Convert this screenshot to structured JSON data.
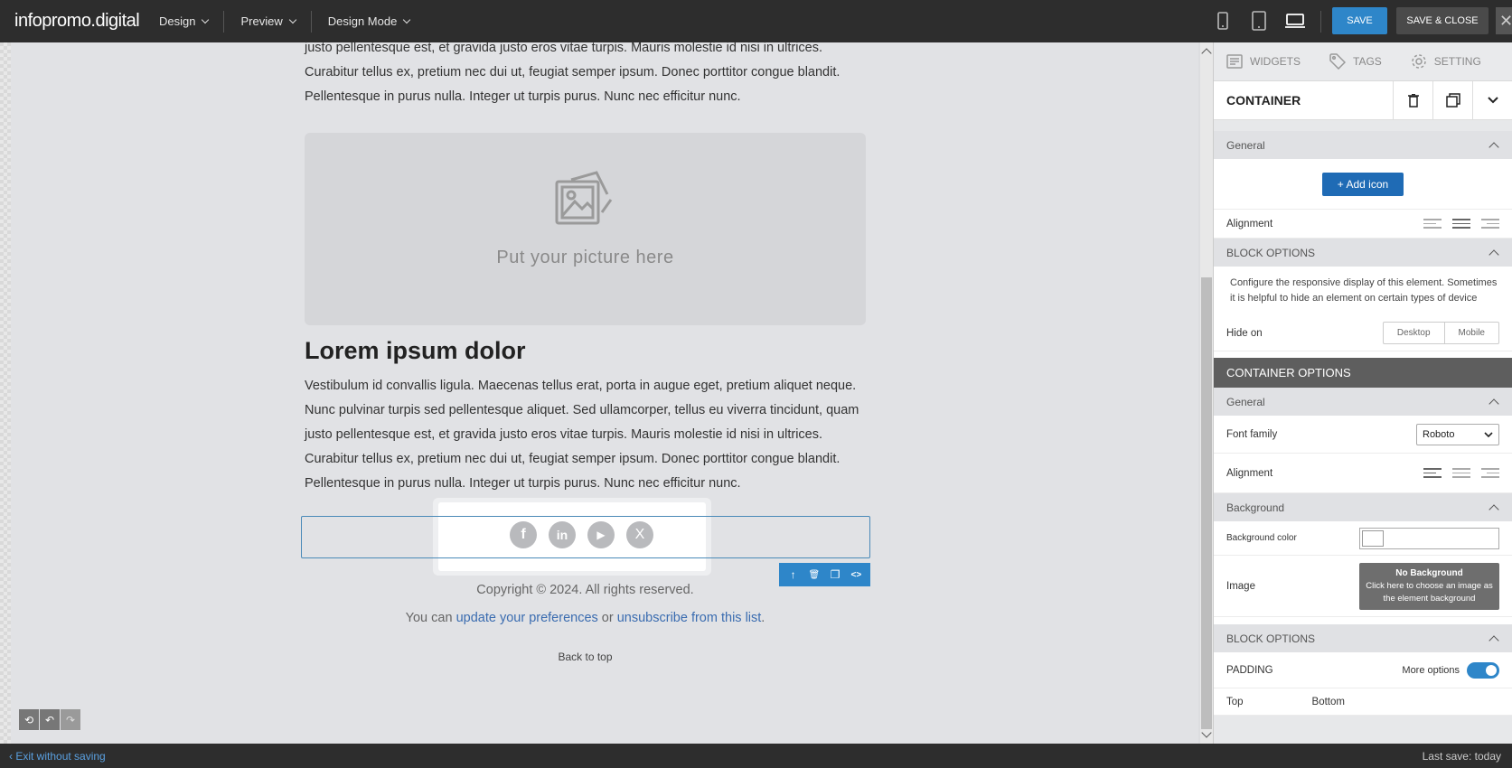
{
  "app": {
    "logo": "infopromo.digital"
  },
  "topbar": {
    "menus": [
      {
        "label": "Design"
      },
      {
        "label": "Preview"
      },
      {
        "label": "Design Mode"
      }
    ],
    "save_label": "SAVE",
    "save_close_label": "SAVE & CLOSE",
    "close_glyph": "✕",
    "devices": [
      "mobile-icon",
      "tablet-icon",
      "desktop-icon"
    ],
    "active_device": "desktop"
  },
  "canvas": {
    "top_paragraph": [
      "justo pellentesque est, et gravida justo eros vitae turpis. Mauris molestie id nisi in ultrices.",
      "Curabitur tellus ex, pretium nec dui ut, feugiat semper ipsum. Donec porttitor congue blandit.",
      "Pellentesque in purus nulla. Integer ut turpis purus. Nunc nec efficitur nunc."
    ],
    "picture_placeholder": "Put your picture here",
    "heading": "Lorem ipsum dolor",
    "body_paragraph": [
      "Vestibulum id convallis ligula. Maecenas tellus erat, porta in augue eget, pretium aliquet neque.",
      "Nunc pulvinar turpis sed pellentesque aliquet. Sed ullamcorper, tellus eu viverra tincidunt, quam",
      "justo pellentesque est, et gravida justo eros vitae turpis. Mauris molestie id nisi in ultrices.",
      "Curabitur tellus ex, pretium nec dui ut, feugiat semper ipsum. Donec porttitor congue blandit.",
      "Pellentesque in purus nulla. Integer ut turpis purus. Nunc nec efficitur nunc."
    ],
    "socials": [
      {
        "icon": "facebook-icon",
        "glyph": "f"
      },
      {
        "icon": "linkedin-icon",
        "glyph": "in"
      },
      {
        "icon": "youtube-icon",
        "glyph": "▶"
      },
      {
        "icon": "x-icon",
        "glyph": "X"
      }
    ],
    "block_toolbar": [
      "↑",
      "🗑",
      "❐",
      "<>"
    ],
    "copyright": "Copyright © 2024. All rights reserved.",
    "prefs": {
      "prefix": "You can",
      "link1": "update your preferences",
      "middle": "or",
      "link2": "unsubscribe from this list",
      "suffix": "."
    },
    "back_to_top": "Back to top",
    "history": [
      "⟲",
      "↶",
      "↷"
    ]
  },
  "panel": {
    "tabs": [
      {
        "label": "WIDGETS",
        "icon": "widgets-icon"
      },
      {
        "label": "TAGS",
        "icon": "tag-icon"
      },
      {
        "label": "SETTING",
        "icon": "gear-icon"
      }
    ],
    "header": {
      "title": "CONTAINER"
    },
    "general_label": "General",
    "add_icon_label": "+ Add icon",
    "alignment_label": "Alignment",
    "block_options_label": "BLOCK OPTIONS",
    "block_desc": "Configure the responsive display of this element. Sometimes it is helpful to hide an element on certain types of device",
    "hide_on_label": "Hide on",
    "hide_desktop": "Desktop",
    "hide_mobile": "Mobile",
    "container_options_label": "CONTAINER OPTIONS",
    "general2_label": "General",
    "font_family_label": "Font family",
    "font_family_value": "Roboto",
    "alignment2_label": "Alignment",
    "background_label": "Background",
    "bg_color_label": "Background color",
    "image_label": "Image",
    "no_bg_title": "No Background",
    "no_bg_text": "Click here to choose an image as the element background",
    "block_options2_label": "BLOCK OPTIONS",
    "padding_label": "PADDING",
    "more_options_label": "More options",
    "more_options_on": true,
    "top_label": "Top",
    "bottom_label": "Bottom"
  },
  "bottombar": {
    "exit_label": "Exit without saving",
    "last_save": "Last save: today"
  },
  "colors": {
    "accent": "#2e86c9",
    "topbar": "#2d2d2d",
    "link": "#3a6cb0"
  }
}
